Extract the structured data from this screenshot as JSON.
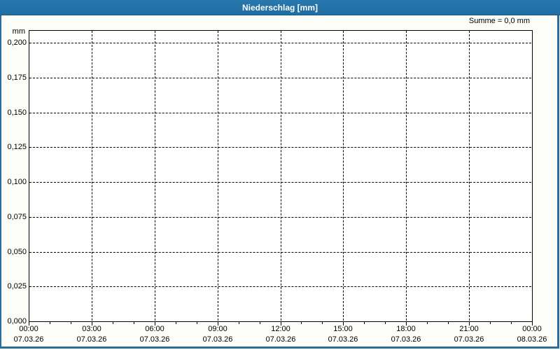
{
  "window": {
    "title": "Niederschlag [mm]"
  },
  "summary": {
    "text": "Summe = 0,0 mm",
    "value_mm": "0,0"
  },
  "colors": {
    "titlebar_blue": "#2171a6",
    "border_blue": "#2a6d9e",
    "panel_background": "#fcfdf8",
    "plot_background": "#ffffff",
    "grid_color": "#000000",
    "title_text": "#ffffff"
  },
  "chart_data": {
    "type": "line",
    "title": "Niederschlag [mm]",
    "ylabel": "mm",
    "unit_label": "mm",
    "ylim": [
      0,
      0.2
    ],
    "grid": "dashed",
    "legend": "none",
    "y_ticks": [
      {
        "value": 0.0,
        "label": "0,000"
      },
      {
        "value": 0.025,
        "label": "0,025"
      },
      {
        "value": 0.05,
        "label": "0,050"
      },
      {
        "value": 0.075,
        "label": "0,075"
      },
      {
        "value": 0.1,
        "label": "0,100"
      },
      {
        "value": 0.125,
        "label": "0,125"
      },
      {
        "value": 0.15,
        "label": "0,150"
      },
      {
        "value": 0.175,
        "label": "0,175"
      },
      {
        "value": 0.2,
        "label": "0,200"
      }
    ],
    "x_ticks": [
      {
        "hour": 0,
        "time": "00:00",
        "date": "07.03.26"
      },
      {
        "hour": 3,
        "time": "03:00",
        "date": "07.03.26"
      },
      {
        "hour": 6,
        "time": "06:00",
        "date": "07.03.26"
      },
      {
        "hour": 9,
        "time": "09:00",
        "date": "07.03.26"
      },
      {
        "hour": 12,
        "time": "12:00",
        "date": "07.03.26"
      },
      {
        "hour": 15,
        "time": "15:00",
        "date": "07.03.26"
      },
      {
        "hour": 18,
        "time": "18:00",
        "date": "07.03.26"
      },
      {
        "hour": 21,
        "time": "21:00",
        "date": "07.03.26"
      },
      {
        "hour": 24,
        "time": "00:00",
        "date": "08.03.26"
      }
    ],
    "x_minor_tick_interval_hours": 1,
    "x_range_hours": [
      0,
      24
    ],
    "series": [
      {
        "name": "Niederschlag",
        "values": []
      }
    ],
    "sum": "0,0 mm"
  }
}
